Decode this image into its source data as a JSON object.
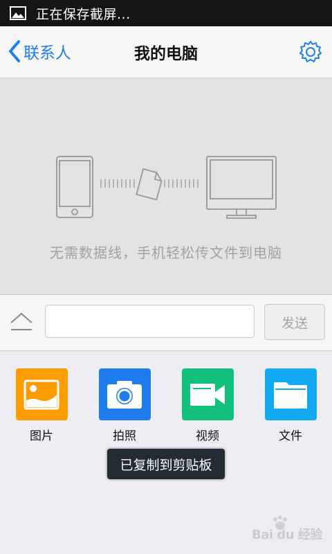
{
  "status_bar": {
    "text": "正在保存截屏..."
  },
  "nav": {
    "back_label": "联系人",
    "title": "我的电脑"
  },
  "hero": {
    "caption": "无需数据线，手机轻松传文件到电脑"
  },
  "input_bar": {
    "placeholder": "",
    "send_label": "发送"
  },
  "actions": [
    {
      "label": "图片",
      "color": "#fd9c00",
      "icon": "image-icon"
    },
    {
      "label": "拍照",
      "color": "#1f7cef",
      "icon": "camera-icon"
    },
    {
      "label": "视频",
      "color": "#12c07c",
      "icon": "video-icon"
    },
    {
      "label": "文件",
      "color": "#13a9f3",
      "icon": "folder-icon"
    }
  ],
  "toast": {
    "text": "已复制到剪贴板"
  },
  "watermark": {
    "text": "Bai du 经验"
  },
  "colors": {
    "accent": "#1a7ff2",
    "status_bar": "#151515",
    "toast": "#232b35"
  }
}
